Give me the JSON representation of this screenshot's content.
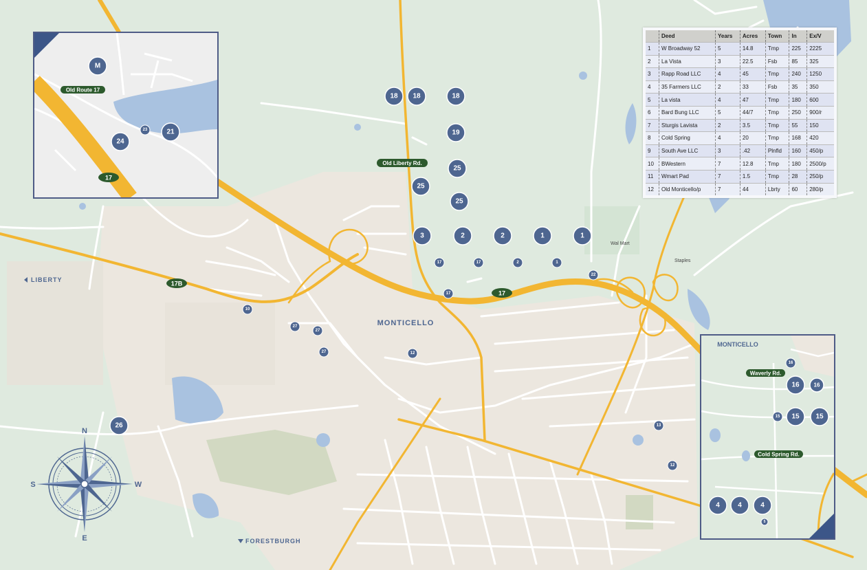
{
  "places": {
    "town": "MONTICELLO",
    "west": "LIBERTY",
    "south": "FORESTBURGH",
    "walmart": "Wal Mart",
    "staples": "Staples"
  },
  "roads": {
    "old_liberty": "Old Liberty Rd.",
    "r17": "17",
    "r17b": "17B"
  },
  "compass": {
    "n": "N",
    "s": "S",
    "e": "E",
    "w": "W"
  },
  "markers": {
    "m18a": "18",
    "m18b": "18",
    "m18c": "18",
    "m19": "19",
    "m25a": "25",
    "m25b": "25",
    "m25c": "25",
    "m3": "3",
    "m2a": "2",
    "m2b": "2",
    "m1a": "1",
    "m1b": "1",
    "s17a": "17",
    "s17b": "17",
    "s2": "2",
    "s1": "1",
    "s17c": "17",
    "s22": "22",
    "s10": "10",
    "s27a": "27",
    "s27b": "27",
    "s27c": "27",
    "s12a": "12",
    "s26": "26",
    "s13": "13",
    "s12b": "12"
  },
  "inset_nw": {
    "marker_m": "M",
    "route_label": "Old Route 17",
    "r17": "17",
    "m24": "24",
    "m23": "23",
    "m21": "21"
  },
  "inset_se": {
    "town": "MONTICELLO",
    "waverly": "Waverly Rd.",
    "cold_spring": "Cold Spring Rd.",
    "m16a": "16",
    "m16b": "16",
    "m16c": "16",
    "m15a": "15",
    "m15b": "15",
    "m15c": "15",
    "m4a": "4",
    "m4b": "4",
    "m4c": "4",
    "m5": "5"
  },
  "deed_table": {
    "headers": [
      "",
      "Deed",
      "Years",
      "Acres",
      "Town",
      "In",
      "Ex/V"
    ],
    "rows": [
      [
        "1",
        "W Broadway 52",
        "5",
        "14.8",
        "Tmp",
        "225",
        "2225"
      ],
      [
        "2",
        "La Vista",
        "3",
        "22.5",
        "Fsb",
        "85",
        "325"
      ],
      [
        "3",
        "Rapp Road LLC",
        "4",
        "45",
        "Tmp",
        "240",
        "1250"
      ],
      [
        "4",
        "35 Farmers LLC",
        "2",
        "33",
        "Fsb",
        "35",
        "350"
      ],
      [
        "5",
        "La vista",
        "4",
        "47",
        "Tmp",
        "180",
        "600"
      ],
      [
        "6",
        "Bard Bung LLC",
        "5",
        "44/7",
        "Tmp",
        "250",
        "900/r"
      ],
      [
        "7",
        "Sturgis Lavista",
        "2",
        "3.5",
        "Tmp",
        "55",
        "150"
      ],
      [
        "8",
        "Cold Spring",
        "4",
        "20",
        "Tmp",
        "168",
        "420"
      ],
      [
        "9",
        "South Ave LLC",
        "3",
        ".42",
        "Plnfld",
        "160",
        "450/p"
      ],
      [
        "10",
        "BWestern",
        "7",
        "12.8",
        "Tmp",
        "180",
        "2500/p"
      ],
      [
        "11",
        "Wmart Pad",
        "7",
        "1.5",
        "Tmp",
        "28",
        "250/p"
      ],
      [
        "12",
        "Old Monticello/p",
        "7",
        "44",
        "Lbrty",
        "60",
        "280/p"
      ]
    ]
  },
  "colors": {
    "background": "#dfeadf",
    "town_area": "#ece7df",
    "road": "#ffffff",
    "highway": "#f2b632",
    "water": "#a9c2e0",
    "marker": "#4e6690",
    "road_label": "#2d5a2d"
  }
}
